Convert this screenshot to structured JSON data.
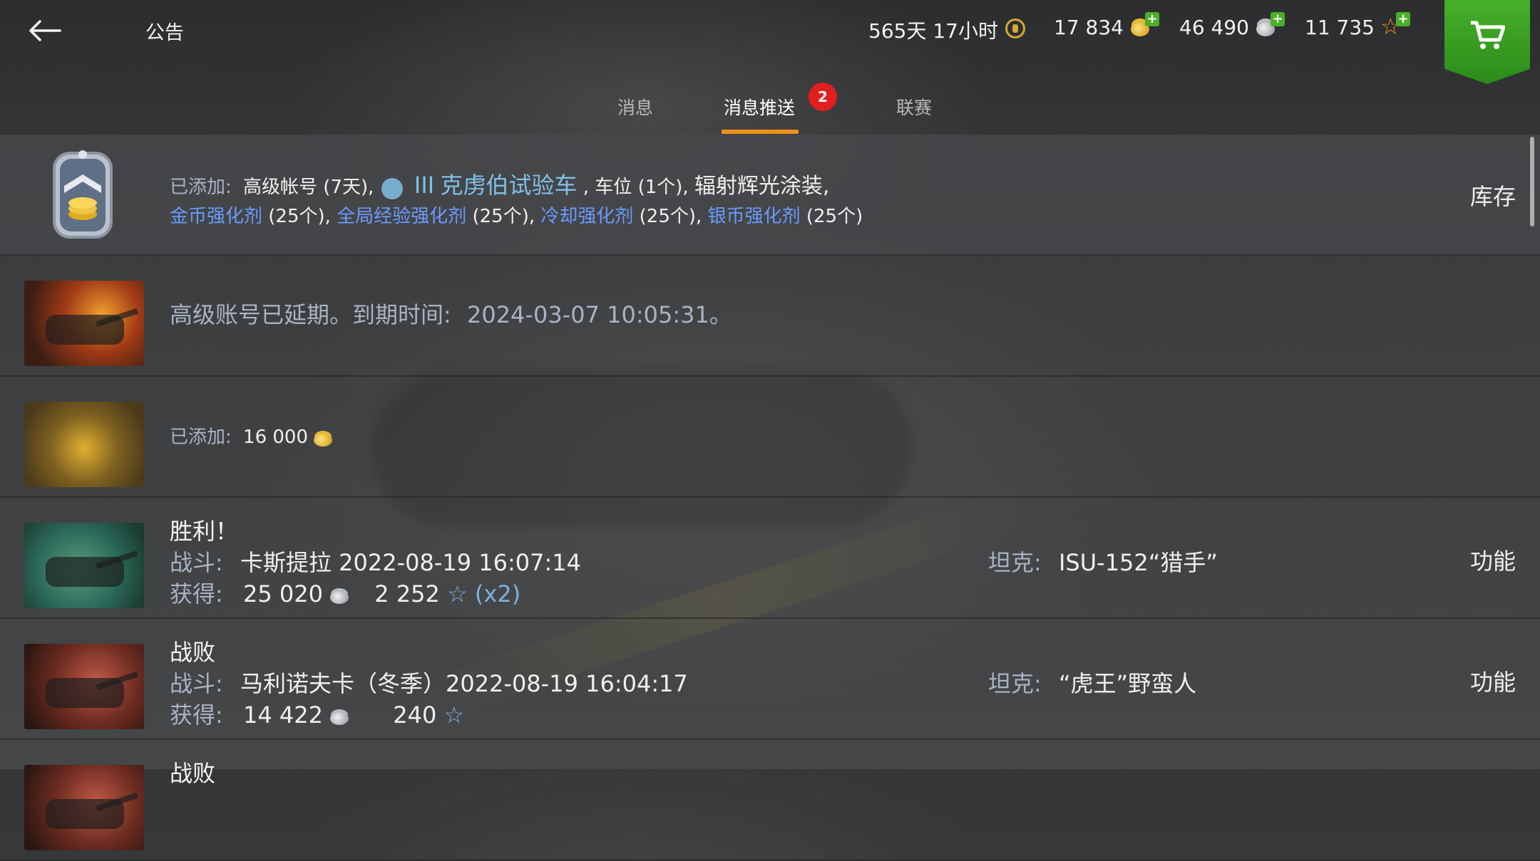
{
  "header": {
    "title": "公告",
    "premium_time": "565天 17小时",
    "gold": "17 834",
    "silver": "46 490",
    "free_xp": "11 735"
  },
  "tabs": [
    {
      "label": "消息"
    },
    {
      "label": "消息推送",
      "active": true,
      "badge": "2"
    },
    {
      "label": "联赛"
    }
  ],
  "messages": {
    "m1": {
      "prefix": "已添加:",
      "premium": "高级帐号 (7天),",
      "tier": "III",
      "vehicle": "克虏伯试验车",
      "slot": ", 车位 (1个),",
      "camo": "辐射辉光涂装,",
      "b1": "金币强化剂",
      "b1n": "(25个),",
      "b2": "全局经验强化剂",
      "b2n": "(25个),",
      "b3": "冷却强化剂",
      "b3n": "(25个),",
      "b4": "银币强化剂",
      "b4n": "(25个)",
      "action": "库存"
    },
    "m2": {
      "text": "高级账号已延期。到期时间:",
      "date": "2024-03-07 10:05:31。"
    },
    "m3": {
      "prefix": "已添加:",
      "amount": "16 000"
    },
    "m4": {
      "title": "胜利！",
      "battle_label": "战斗:",
      "battle_value": "卡斯提拉 2022-08-19 16:07:14",
      "tank_label": "坦克:",
      "tank_value": "ISU-152“猎手”",
      "earn_label": "获得:",
      "silver": "25 020",
      "xp": "2 252",
      "xp_mult": "(x2)",
      "action": "功能"
    },
    "m5": {
      "title": "战败",
      "battle_label": "战斗:",
      "battle_value": "马利诺夫卡（冬季）2022-08-19 16:04:17",
      "tank_label": "坦克:",
      "tank_value": "“虎王”野蛮人",
      "earn_label": "获得:",
      "silver": "14 422",
      "xp": "240",
      "action": "功能"
    },
    "m6": {
      "title": "战败"
    }
  },
  "colors": {
    "accent_tab": "#ef8f1a",
    "badge": "#e31e1e",
    "shop": "#3a9e22",
    "link": "#6a9bff"
  }
}
